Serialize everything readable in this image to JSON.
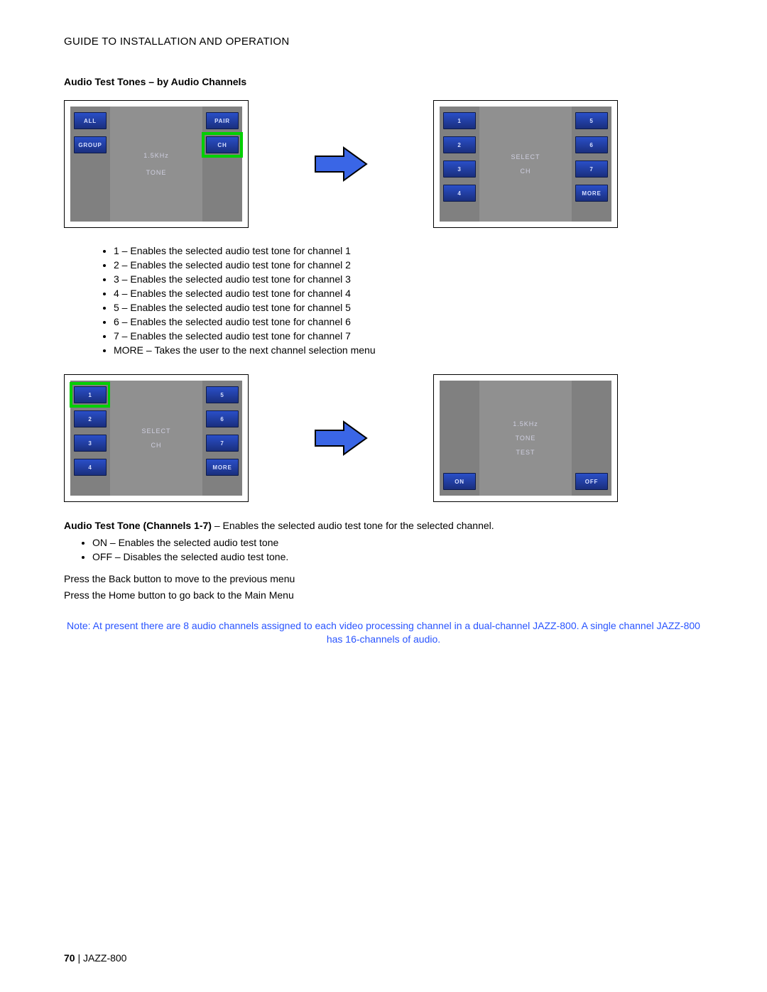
{
  "header": {
    "title": "GUIDE TO INSTALLATION AND OPERATION"
  },
  "section": {
    "title": "Audio Test Tones – by Audio Channels"
  },
  "screen1": {
    "left": [
      "ALL",
      "GROUP"
    ],
    "right": [
      "PAIR",
      "CH"
    ],
    "center": [
      "1.5KHz",
      "TONE"
    ],
    "highlight": "right-1"
  },
  "screen2": {
    "left": [
      "1",
      "2",
      "3",
      "4"
    ],
    "right": [
      "5",
      "6",
      "7",
      "MORE"
    ],
    "center": [
      "SELECT",
      "CH"
    ]
  },
  "bullets1": [
    "1 – Enables the selected audio test tone for channel 1",
    "2 – Enables the selected audio test tone for channel 2",
    "3 – Enables the selected audio test tone for channel 3",
    "4 – Enables the selected audio test tone for channel 4",
    "5 – Enables the selected audio test tone for channel 5",
    "6 – Enables the selected audio test tone for channel 6",
    "7 – Enables the selected audio test tone for channel 7",
    "MORE – Takes the user to the next channel selection menu"
  ],
  "screen3": {
    "left": [
      "1",
      "2",
      "3",
      "4"
    ],
    "right": [
      "5",
      "6",
      "7",
      "MORE"
    ],
    "center": [
      "SELECT",
      "CH"
    ],
    "highlight": "left-0"
  },
  "screen4": {
    "left_bottom": "ON",
    "right_bottom": "OFF",
    "center": [
      "1.5KHz",
      "TONE",
      "TEST"
    ]
  },
  "para1_bold": "Audio Test Tone (Channels 1-7)",
  "para1_rest": " – Enables the selected audio test tone for the selected channel.",
  "bullets2": [
    "ON – Enables the selected audio test tone",
    "OFF – Disables the selected audio test tone."
  ],
  "nav_lines": [
    "Press the Back button to move to the previous menu",
    "Press the Home button to go back to the Main Menu"
  ],
  "note": "Note: At present there are 8 audio channels assigned to each video processing channel in a dual-channel JAZZ-800. A single channel JAZZ-800 has 16-channels of audio.",
  "footer": {
    "page": "70",
    "sep": " | ",
    "model": "JAZZ-800"
  }
}
